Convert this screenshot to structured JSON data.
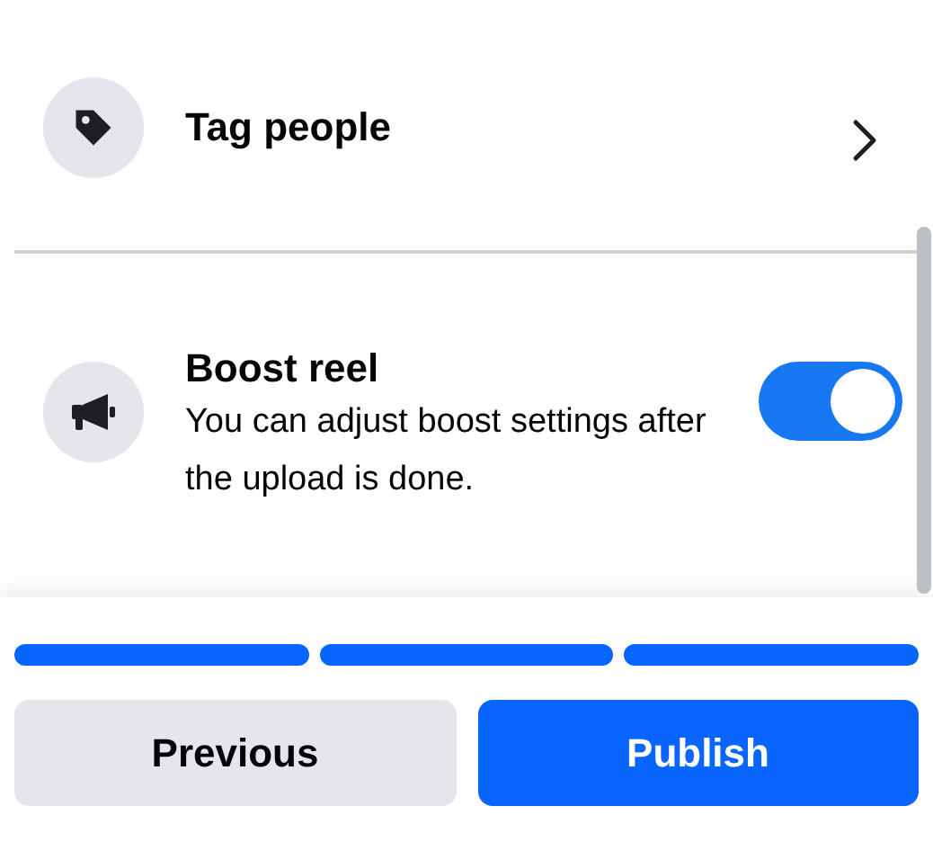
{
  "options": [
    {
      "kind": "link",
      "label": "Tag people"
    },
    {
      "kind": "toggle",
      "label": "Boost reel",
      "description": "You can adjust boost settings after the upload is done.",
      "on": true
    }
  ],
  "steps": [
    {
      "complete": true
    },
    {
      "complete": true
    },
    {
      "complete": true
    }
  ],
  "buttons": [
    {
      "label": "Previous",
      "primary": false
    },
    {
      "label": "Publish",
      "primary": true
    }
  ]
}
